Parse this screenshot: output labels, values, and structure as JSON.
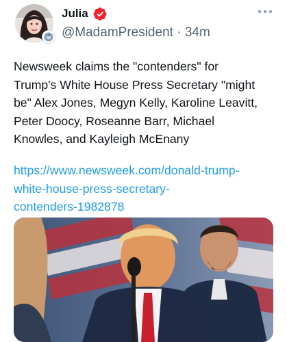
{
  "author": {
    "display_name": "Julia",
    "handle": "@MadamPresident",
    "separator": " · ",
    "time_ago": "34m",
    "verified": true,
    "avatar_icon": "profile-photo",
    "badge_icon": "affiliate-badge-icon"
  },
  "tweet": {
    "text": "Newsweek claims the \"contenders\" for\nTrump's White House Press Secretary \"might\nbe\" Alex Jones, Megyn Kelly, Karoline Leavitt,\nPeter Doocy, Roseanne Barr, Michael\nKnowles, and Kayleigh McEnany",
    "link": "https://www.newsweek.com/donald-trump-\nwhite-house-press-secretary-\ncontenders-1982878"
  },
  "colors": {
    "link": "#1d9bf0",
    "verified": "#f4212e",
    "secondary_text": "#536471"
  },
  "icons": {
    "more": "more-options-icon",
    "verified": "verified-badge-icon"
  }
}
